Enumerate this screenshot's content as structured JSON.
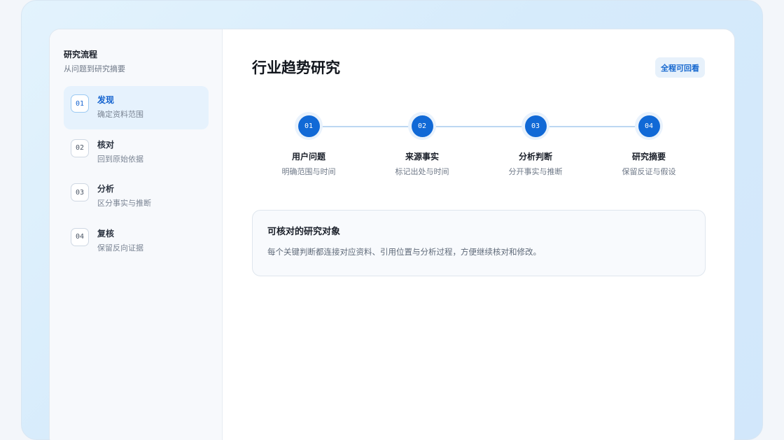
{
  "sidebar": {
    "title": "研究流程",
    "subtitle": "从问题到研究摘要",
    "steps": [
      {
        "num": "01",
        "label": "发现",
        "desc": "确定资料范围"
      },
      {
        "num": "02",
        "label": "核对",
        "desc": "回到原始依据"
      },
      {
        "num": "03",
        "label": "分析",
        "desc": "区分事实与推断"
      },
      {
        "num": "04",
        "label": "复核",
        "desc": "保留反向证据"
      }
    ]
  },
  "main": {
    "title": "行业趋势研究",
    "badge": "全程可回看",
    "flow": [
      {
        "num": "01",
        "label": "用户问题",
        "desc": "明确范围与时间"
      },
      {
        "num": "02",
        "label": "来源事实",
        "desc": "标记出处与时间"
      },
      {
        "num": "03",
        "label": "分析判断",
        "desc": "分开事实与推断"
      },
      {
        "num": "04",
        "label": "研究摘要",
        "desc": "保留反证与假设"
      }
    ],
    "info": {
      "title": "可核对的研究对象",
      "text": "每个关键判断都连接对应资料、引用位置与分析过程，方便继续核对和修改。"
    }
  },
  "colors": {
    "accent": "#1169d6",
    "active_bg": "#e6f2fd",
    "badge_bg": "#e7f1fb"
  }
}
